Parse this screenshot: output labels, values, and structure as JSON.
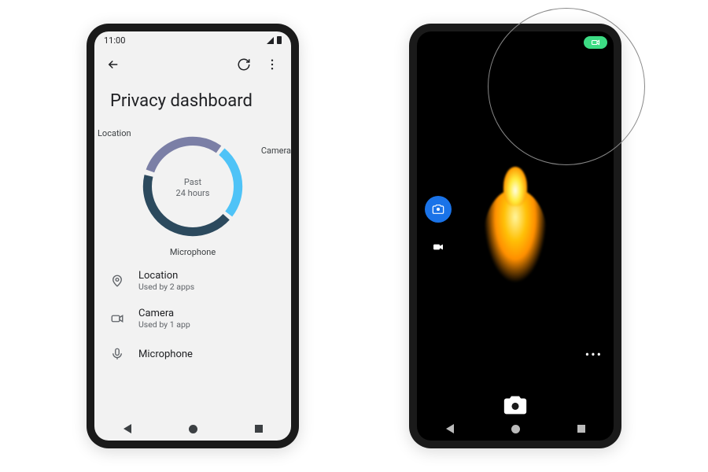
{
  "left_phone": {
    "statusbar": {
      "time": "11:00"
    },
    "page_title": "Privacy dashboard",
    "donut": {
      "center_line1": "Past",
      "center_line2": "24 hours",
      "segments": [
        {
          "label": "Location",
          "color": "#7b7fa6"
        },
        {
          "label": "Camera",
          "color": "#4fc3f7"
        },
        {
          "label": "Microphone",
          "color": "#2c4a5e"
        }
      ]
    },
    "list": [
      {
        "icon": "location-pin-icon",
        "title": "Location",
        "subtitle": "Used by 2 apps"
      },
      {
        "icon": "camera-icon",
        "title": "Camera",
        "subtitle": "Used by 1 app"
      },
      {
        "icon": "microphone-icon",
        "title": "Microphone",
        "subtitle": ""
      }
    ]
  },
  "right_phone": {
    "indicator": {
      "icon": "camera-icon",
      "color": "#3ddc84"
    },
    "modes": {
      "photo_label": "photo",
      "video_label": "video"
    },
    "more_label": "•••",
    "shutter_label": "capture"
  }
}
